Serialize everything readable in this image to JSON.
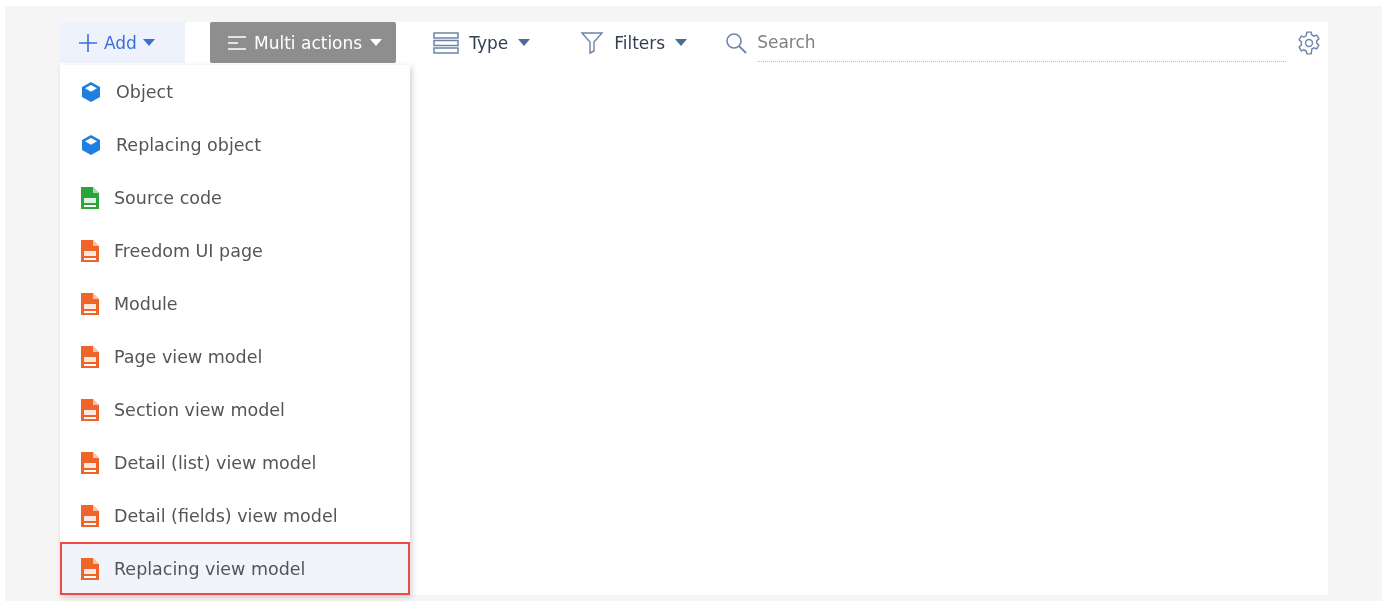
{
  "toolbar": {
    "add_button": {
      "label": "Add",
      "expanded": true
    },
    "multi_actions_button": {
      "label": "Multi actions"
    },
    "type_button": {
      "label": "Type"
    },
    "filters_button": {
      "label": "Filters"
    },
    "search": {
      "placeholder": "Search"
    }
  },
  "add_menu": {
    "items": [
      {
        "label": "Object",
        "kind": "object",
        "selected": false
      },
      {
        "label": "Replacing object",
        "kind": "object",
        "selected": false
      },
      {
        "label": "Source code",
        "kind": "csharp",
        "selected": false
      },
      {
        "label": "Freedom UI page",
        "kind": "js",
        "selected": false
      },
      {
        "label": "Module",
        "kind": "js",
        "selected": false
      },
      {
        "label": "Page view model",
        "kind": "js",
        "selected": false
      },
      {
        "label": "Section view model",
        "kind": "js",
        "selected": false
      },
      {
        "label": "Detail (list) view model",
        "kind": "js",
        "selected": false
      },
      {
        "label": "Detail (fields) view model",
        "kind": "js",
        "selected": false
      },
      {
        "label": "Replacing view model",
        "kind": "js",
        "selected": true
      }
    ]
  }
}
